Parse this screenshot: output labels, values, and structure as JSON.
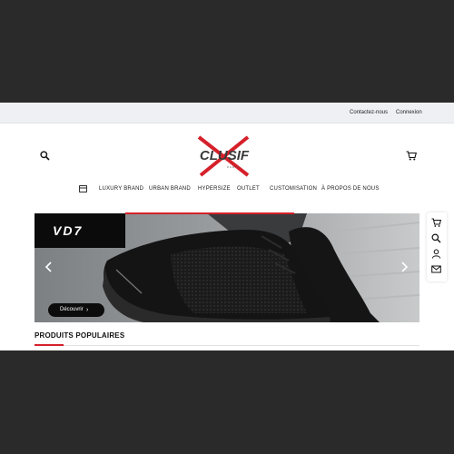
{
  "topbar": {
    "contact_label": "Contactez-nous",
    "login_label": "Connexion"
  },
  "logo": {
    "text": "CLUSIF",
    "subtext": "PARIS"
  },
  "icons": {
    "search": "search-icon",
    "cart": "cart-icon",
    "shop": "shop-icon",
    "user": "user-icon",
    "mail": "mail-icon",
    "zoom": "zoom-icon"
  },
  "nav": {
    "items": [
      "LUXURY BRAND",
      "URBAN BRAND",
      "HYPERSIZE",
      "OUTLET",
      "CUSTOMISATION",
      "À PROPOS DE NOUS"
    ]
  },
  "hero": {
    "brand": "VD7",
    "cta_label": "Découvrir"
  },
  "section": {
    "title": "PRODUITS POPULAIRES"
  },
  "colors": {
    "accent": "#d5202a",
    "dark": "#0b0b0b",
    "topbar": "#eef0f3"
  }
}
